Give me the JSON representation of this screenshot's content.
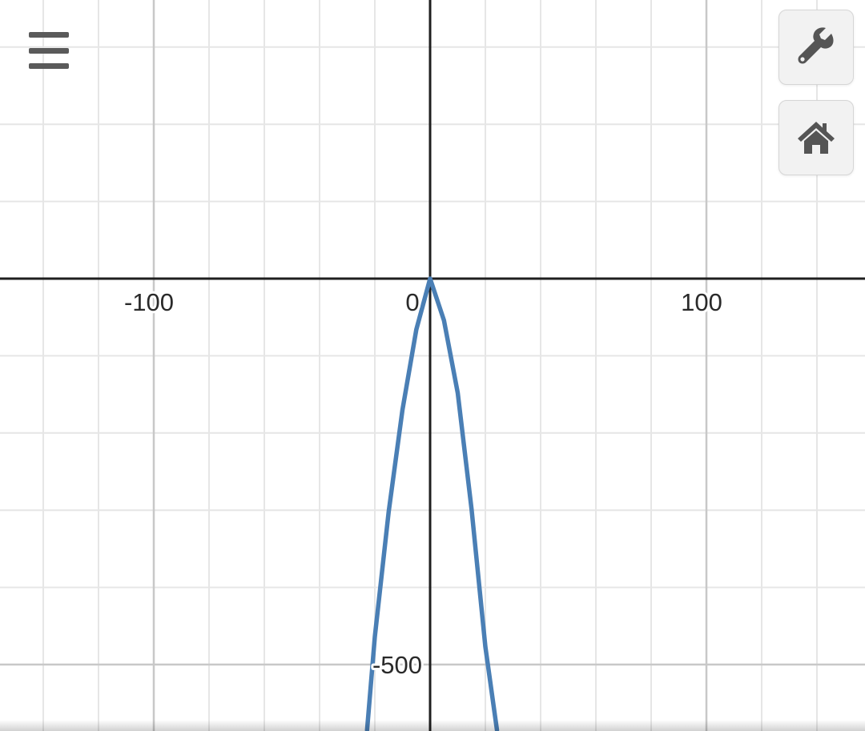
{
  "graph": {
    "x_ticks": [
      "-100",
      "0",
      "100"
    ],
    "y_ticks": [
      "-500"
    ],
    "curve": {
      "color": "#4a7fb5",
      "expression_note_hidden": true
    }
  },
  "chart_data": {
    "type": "line",
    "x_range": [
      -156.5,
      157.0
    ],
    "y_range": [
      -585,
      350
    ],
    "grid": true,
    "x_tick_values": [
      -100,
      0,
      100
    ],
    "y_tick_values": [
      -500
    ],
    "series": [
      {
        "color": "#4a7fb5",
        "x": [
          -22.8,
          -20,
          -15,
          -10,
          -5,
          0,
          5,
          10,
          15,
          20,
          24.2
        ],
        "y": [
          -585,
          -464,
          -302,
          -170,
          -66,
          0,
          -54,
          -148,
          -299,
          -477,
          -585
        ]
      }
    ]
  },
  "controls": {
    "menu_icon": "hamburger-menu-icon",
    "settings_icon": "wrench-icon",
    "home_icon": "home-icon"
  }
}
